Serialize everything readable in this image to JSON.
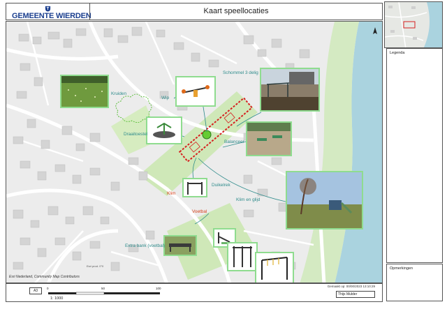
{
  "header": {
    "municipality": "GEMEENTE",
    "municipality_w": "WIERDEN",
    "title": "Kaart speellocaties"
  },
  "map": {
    "credits": "Esri Nederland, Community Map Contributors",
    "north_arrow": "north-arrow-icon",
    "colors": {
      "water": "#aad3df",
      "green": "#c8e6b0",
      "road": "#ffffff",
      "building": "#cfcfcf",
      "label": "#2e8b8b",
      "highlight": "#d61f1f",
      "photo_border": "#8fdc8f"
    },
    "labels": {
      "kruiden": "Kruiden",
      "wip": "Wip",
      "schommel": "Schommel 3 delig",
      "draaitoestel": "Draaitoestel",
      "balanceer": "Balanceer",
      "duikelrek": "Duikelrek",
      "klim_en_glijd": "Klim en glijd",
      "klim": "Klim",
      "voetbal": "Voetbal",
      "extra_bank": "Extra bank (voetbal)",
      "esri_label": "Esri prod. 0°0"
    }
  },
  "legend": {
    "title": "Legenda"
  },
  "remarks": {
    "title": "Opmerkingen"
  },
  "footer": {
    "paper_size": "A3",
    "scale_label": "1: 1000",
    "scale_ticks": [
      "0",
      "50",
      "100"
    ],
    "created_on": "Gemaakt op: 00/00/2023 13:10:29",
    "author": "Thijs Mulder"
  }
}
